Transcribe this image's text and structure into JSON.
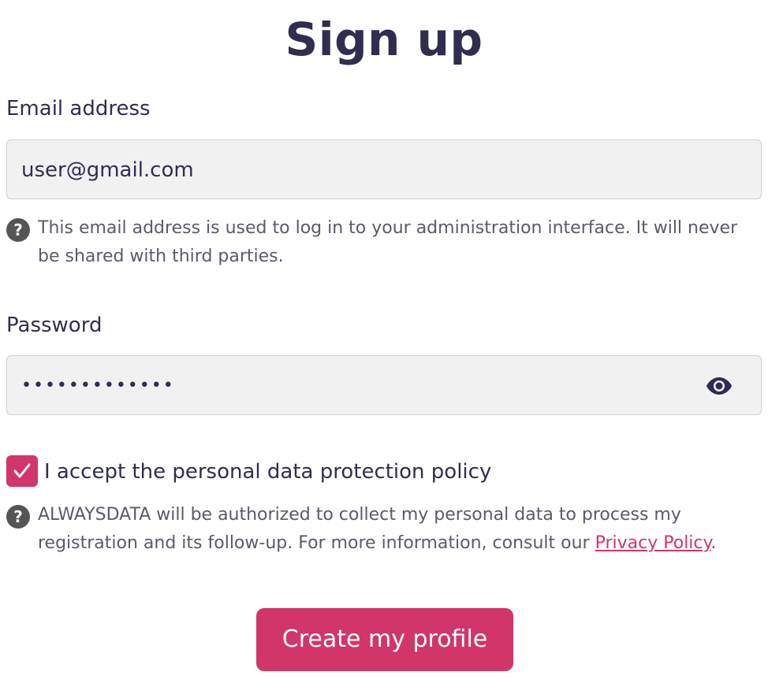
{
  "page": {
    "title": "Sign up"
  },
  "email": {
    "label": "Email address",
    "value": "user@gmail.com",
    "help": "This email address is used to log in to your administration interface. It will never be shared with third parties."
  },
  "password": {
    "label": "Password",
    "masked_value": "•••••••••••••",
    "toggle_icon": "eye-icon"
  },
  "consent": {
    "checked": true,
    "label": "I accept the personal data protection policy",
    "help_prefix": "ALWAYSDATA will be authorized to collect my personal data to process my registration and its follow-up. For more information, consult our ",
    "link_text": "Privacy Policy",
    "help_suffix": "."
  },
  "submit": {
    "label": "Create my profile"
  },
  "colors": {
    "accent": "#d1356a",
    "heading": "#2f2e50",
    "input_bg": "#f1f1f1",
    "help_icon": "#555555"
  }
}
